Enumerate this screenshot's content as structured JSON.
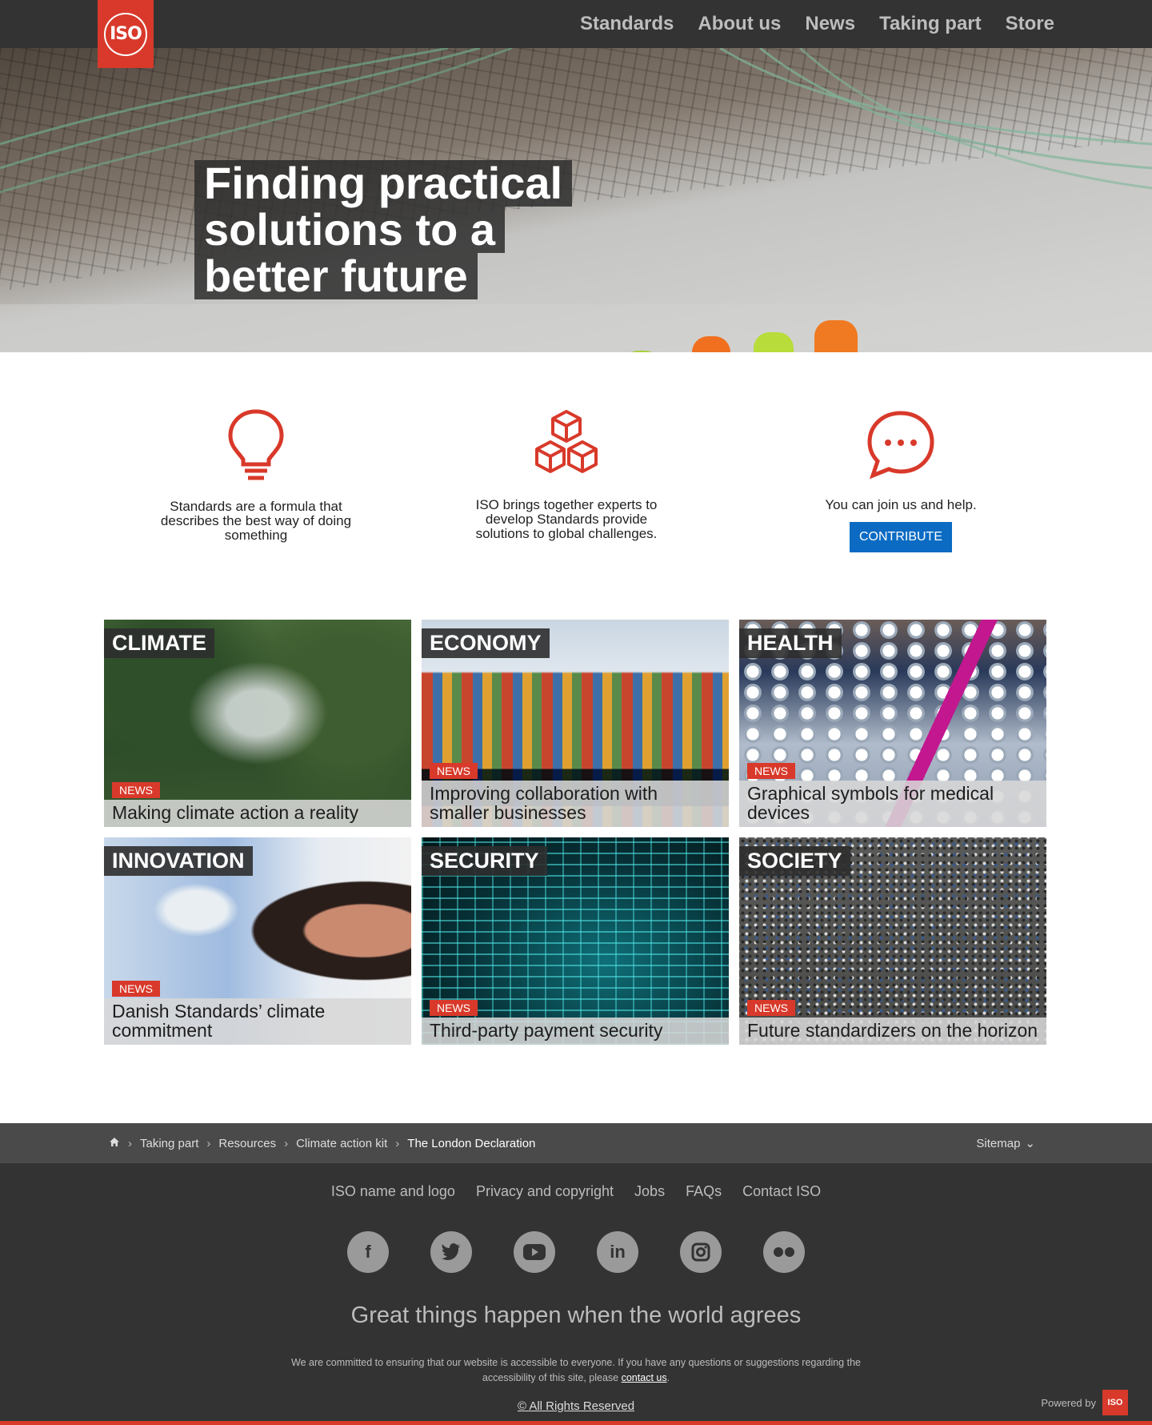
{
  "brand": {
    "logo_text": "ISO",
    "accent": "#d8392a",
    "dark": "#333333",
    "cta_blue": "#0b6bc3"
  },
  "nav": {
    "items": [
      "Standards",
      "About us",
      "News",
      "Taking part",
      "Store"
    ]
  },
  "hero": {
    "lines": [
      "Finding practical",
      "solutions to a",
      "better future"
    ]
  },
  "features": [
    {
      "icon": "lightbulb-icon",
      "text": "Standards are a formula that describes the best way of doing something"
    },
    {
      "icon": "cubes-icon",
      "text": "ISO brings together experts to develop Standards provide solutions to global challenges."
    },
    {
      "icon": "chat-bubble-icon",
      "text": "You can join us and help.",
      "button": "CONTRIBUTE"
    }
  ],
  "cards": [
    {
      "category": "CLIMATE",
      "badge": "NEWS",
      "headline": "Making climate action a reality"
    },
    {
      "category": "ECONOMY",
      "badge": "NEWS",
      "headline": "Improving collaboration with smaller businesses"
    },
    {
      "category": "HEALTH",
      "badge": "NEWS",
      "headline": "Graphical symbols for medical devices"
    },
    {
      "category": "INNOVATION",
      "badge": "NEWS",
      "headline": "Danish Standards’ climate commitment"
    },
    {
      "category": "SECURITY",
      "badge": "NEWS",
      "headline": "Third-party payment security"
    },
    {
      "category": "SOCIETY",
      "badge": "NEWS",
      "headline": "Future standardizers on the horizon"
    }
  ],
  "breadcrumb": {
    "items": [
      "Taking part",
      "Resources",
      "Climate action kit"
    ],
    "current": "The London Declaration",
    "sitemap": "Sitemap"
  },
  "footer": {
    "links": [
      "ISO name and logo",
      "Privacy and copyright",
      "Jobs",
      "FAQs",
      "Contact ISO"
    ],
    "social": [
      "facebook-icon",
      "twitter-icon",
      "youtube-icon",
      "linkedin-icon",
      "instagram-icon",
      "flickr-icon"
    ],
    "tagline": "Great things happen when the world agrees",
    "access_text": "We are committed to ensuring that our website is accessible to everyone. If you have any questions or suggestions regarding the accessibility of this site, please",
    "access_link": "contact us",
    "copyright": "© All Rights Reserved",
    "powered_by": "Powered by",
    "powered_logo": "ISO"
  }
}
